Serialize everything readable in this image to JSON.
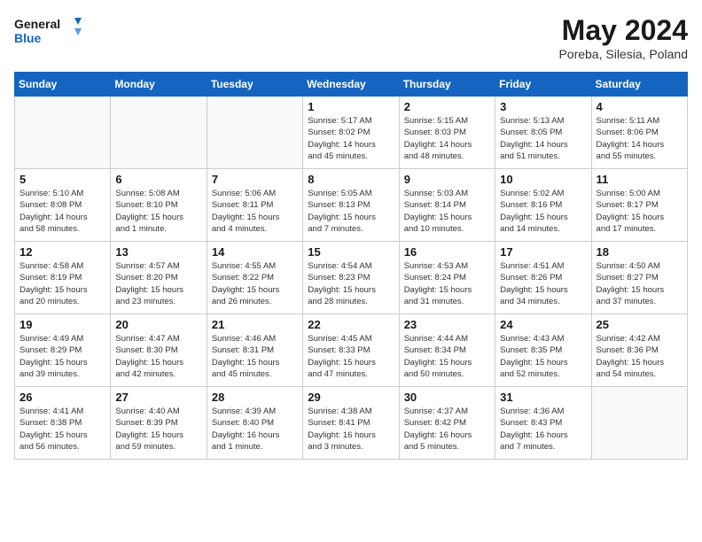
{
  "logo": {
    "line1": "General",
    "line2": "Blue"
  },
  "title": "May 2024",
  "subtitle": "Poreba, Silesia, Poland",
  "days_of_week": [
    "Sunday",
    "Monday",
    "Tuesday",
    "Wednesday",
    "Thursday",
    "Friday",
    "Saturday"
  ],
  "weeks": [
    [
      {
        "day": "",
        "info": ""
      },
      {
        "day": "",
        "info": ""
      },
      {
        "day": "",
        "info": ""
      },
      {
        "day": "1",
        "info": "Sunrise: 5:17 AM\nSunset: 8:02 PM\nDaylight: 14 hours\nand 45 minutes."
      },
      {
        "day": "2",
        "info": "Sunrise: 5:15 AM\nSunset: 8:03 PM\nDaylight: 14 hours\nand 48 minutes."
      },
      {
        "day": "3",
        "info": "Sunrise: 5:13 AM\nSunset: 8:05 PM\nDaylight: 14 hours\nand 51 minutes."
      },
      {
        "day": "4",
        "info": "Sunrise: 5:11 AM\nSunset: 8:06 PM\nDaylight: 14 hours\nand 55 minutes."
      }
    ],
    [
      {
        "day": "5",
        "info": "Sunrise: 5:10 AM\nSunset: 8:08 PM\nDaylight: 14 hours\nand 58 minutes."
      },
      {
        "day": "6",
        "info": "Sunrise: 5:08 AM\nSunset: 8:10 PM\nDaylight: 15 hours\nand 1 minute."
      },
      {
        "day": "7",
        "info": "Sunrise: 5:06 AM\nSunset: 8:11 PM\nDaylight: 15 hours\nand 4 minutes."
      },
      {
        "day": "8",
        "info": "Sunrise: 5:05 AM\nSunset: 8:13 PM\nDaylight: 15 hours\nand 7 minutes."
      },
      {
        "day": "9",
        "info": "Sunrise: 5:03 AM\nSunset: 8:14 PM\nDaylight: 15 hours\nand 10 minutes."
      },
      {
        "day": "10",
        "info": "Sunrise: 5:02 AM\nSunset: 8:16 PM\nDaylight: 15 hours\nand 14 minutes."
      },
      {
        "day": "11",
        "info": "Sunrise: 5:00 AM\nSunset: 8:17 PM\nDaylight: 15 hours\nand 17 minutes."
      }
    ],
    [
      {
        "day": "12",
        "info": "Sunrise: 4:58 AM\nSunset: 8:19 PM\nDaylight: 15 hours\nand 20 minutes."
      },
      {
        "day": "13",
        "info": "Sunrise: 4:57 AM\nSunset: 8:20 PM\nDaylight: 15 hours\nand 23 minutes."
      },
      {
        "day": "14",
        "info": "Sunrise: 4:55 AM\nSunset: 8:22 PM\nDaylight: 15 hours\nand 26 minutes."
      },
      {
        "day": "15",
        "info": "Sunrise: 4:54 AM\nSunset: 8:23 PM\nDaylight: 15 hours\nand 28 minutes."
      },
      {
        "day": "16",
        "info": "Sunrise: 4:53 AM\nSunset: 8:24 PM\nDaylight: 15 hours\nand 31 minutes."
      },
      {
        "day": "17",
        "info": "Sunrise: 4:51 AM\nSunset: 8:26 PM\nDaylight: 15 hours\nand 34 minutes."
      },
      {
        "day": "18",
        "info": "Sunrise: 4:50 AM\nSunset: 8:27 PM\nDaylight: 15 hours\nand 37 minutes."
      }
    ],
    [
      {
        "day": "19",
        "info": "Sunrise: 4:49 AM\nSunset: 8:29 PM\nDaylight: 15 hours\nand 39 minutes."
      },
      {
        "day": "20",
        "info": "Sunrise: 4:47 AM\nSunset: 8:30 PM\nDaylight: 15 hours\nand 42 minutes."
      },
      {
        "day": "21",
        "info": "Sunrise: 4:46 AM\nSunset: 8:31 PM\nDaylight: 15 hours\nand 45 minutes."
      },
      {
        "day": "22",
        "info": "Sunrise: 4:45 AM\nSunset: 8:33 PM\nDaylight: 15 hours\nand 47 minutes."
      },
      {
        "day": "23",
        "info": "Sunrise: 4:44 AM\nSunset: 8:34 PM\nDaylight: 15 hours\nand 50 minutes."
      },
      {
        "day": "24",
        "info": "Sunrise: 4:43 AM\nSunset: 8:35 PM\nDaylight: 15 hours\nand 52 minutes."
      },
      {
        "day": "25",
        "info": "Sunrise: 4:42 AM\nSunset: 8:36 PM\nDaylight: 15 hours\nand 54 minutes."
      }
    ],
    [
      {
        "day": "26",
        "info": "Sunrise: 4:41 AM\nSunset: 8:38 PM\nDaylight: 15 hours\nand 56 minutes."
      },
      {
        "day": "27",
        "info": "Sunrise: 4:40 AM\nSunset: 8:39 PM\nDaylight: 15 hours\nand 59 minutes."
      },
      {
        "day": "28",
        "info": "Sunrise: 4:39 AM\nSunset: 8:40 PM\nDaylight: 16 hours\nand 1 minute."
      },
      {
        "day": "29",
        "info": "Sunrise: 4:38 AM\nSunset: 8:41 PM\nDaylight: 16 hours\nand 3 minutes."
      },
      {
        "day": "30",
        "info": "Sunrise: 4:37 AM\nSunset: 8:42 PM\nDaylight: 16 hours\nand 5 minutes."
      },
      {
        "day": "31",
        "info": "Sunrise: 4:36 AM\nSunset: 8:43 PM\nDaylight: 16 hours\nand 7 minutes."
      },
      {
        "day": "",
        "info": ""
      }
    ]
  ]
}
